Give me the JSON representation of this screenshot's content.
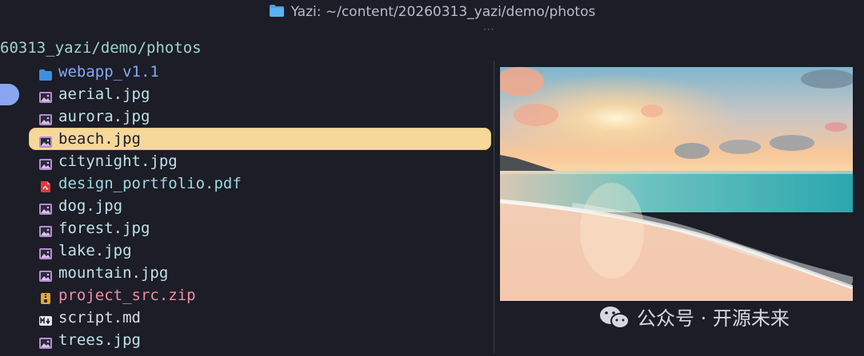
{
  "window": {
    "title": "Yazi: ~/content/20260313_yazi/demo/photos"
  },
  "header": {
    "path": "60313_yazi/demo/photos",
    "overflow_dots": "···"
  },
  "files": [
    {
      "name": "webapp_v1.1",
      "icon": "folder-icon",
      "kind": "dir"
    },
    {
      "name": "aerial.jpg",
      "icon": "image-icon",
      "kind": "img"
    },
    {
      "name": "aurora.jpg",
      "icon": "image-icon",
      "kind": "img"
    },
    {
      "name": "beach.jpg",
      "icon": "image-icon",
      "kind": "img",
      "selected": true
    },
    {
      "name": "citynight.jpg",
      "icon": "image-icon",
      "kind": "img"
    },
    {
      "name": "design_portfolio.pdf",
      "icon": "pdf-icon",
      "kind": "pdf"
    },
    {
      "name": "dog.jpg",
      "icon": "image-icon",
      "kind": "img"
    },
    {
      "name": "forest.jpg",
      "icon": "image-icon",
      "kind": "img"
    },
    {
      "name": "lake.jpg",
      "icon": "image-icon",
      "kind": "img"
    },
    {
      "name": "mountain.jpg",
      "icon": "image-icon",
      "kind": "img"
    },
    {
      "name": "project_src.zip",
      "icon": "zip-icon",
      "kind": "zip"
    },
    {
      "name": "script.md",
      "icon": "markdown-icon",
      "kind": "md"
    },
    {
      "name": "trees.jpg",
      "icon": "image-icon",
      "kind": "img"
    }
  ],
  "preview": {
    "image": "beach-sunset-preview"
  },
  "watermark": {
    "text": "公众号 · 开源未来",
    "icon": "wechat-icon"
  },
  "colors": {
    "background": "#1c1d27",
    "selection": "#f6d89a",
    "directory": "#86a8f3",
    "image_file": "#bfe1e8",
    "archive_file": "#f08ca7",
    "path": "#9ed6c8"
  }
}
